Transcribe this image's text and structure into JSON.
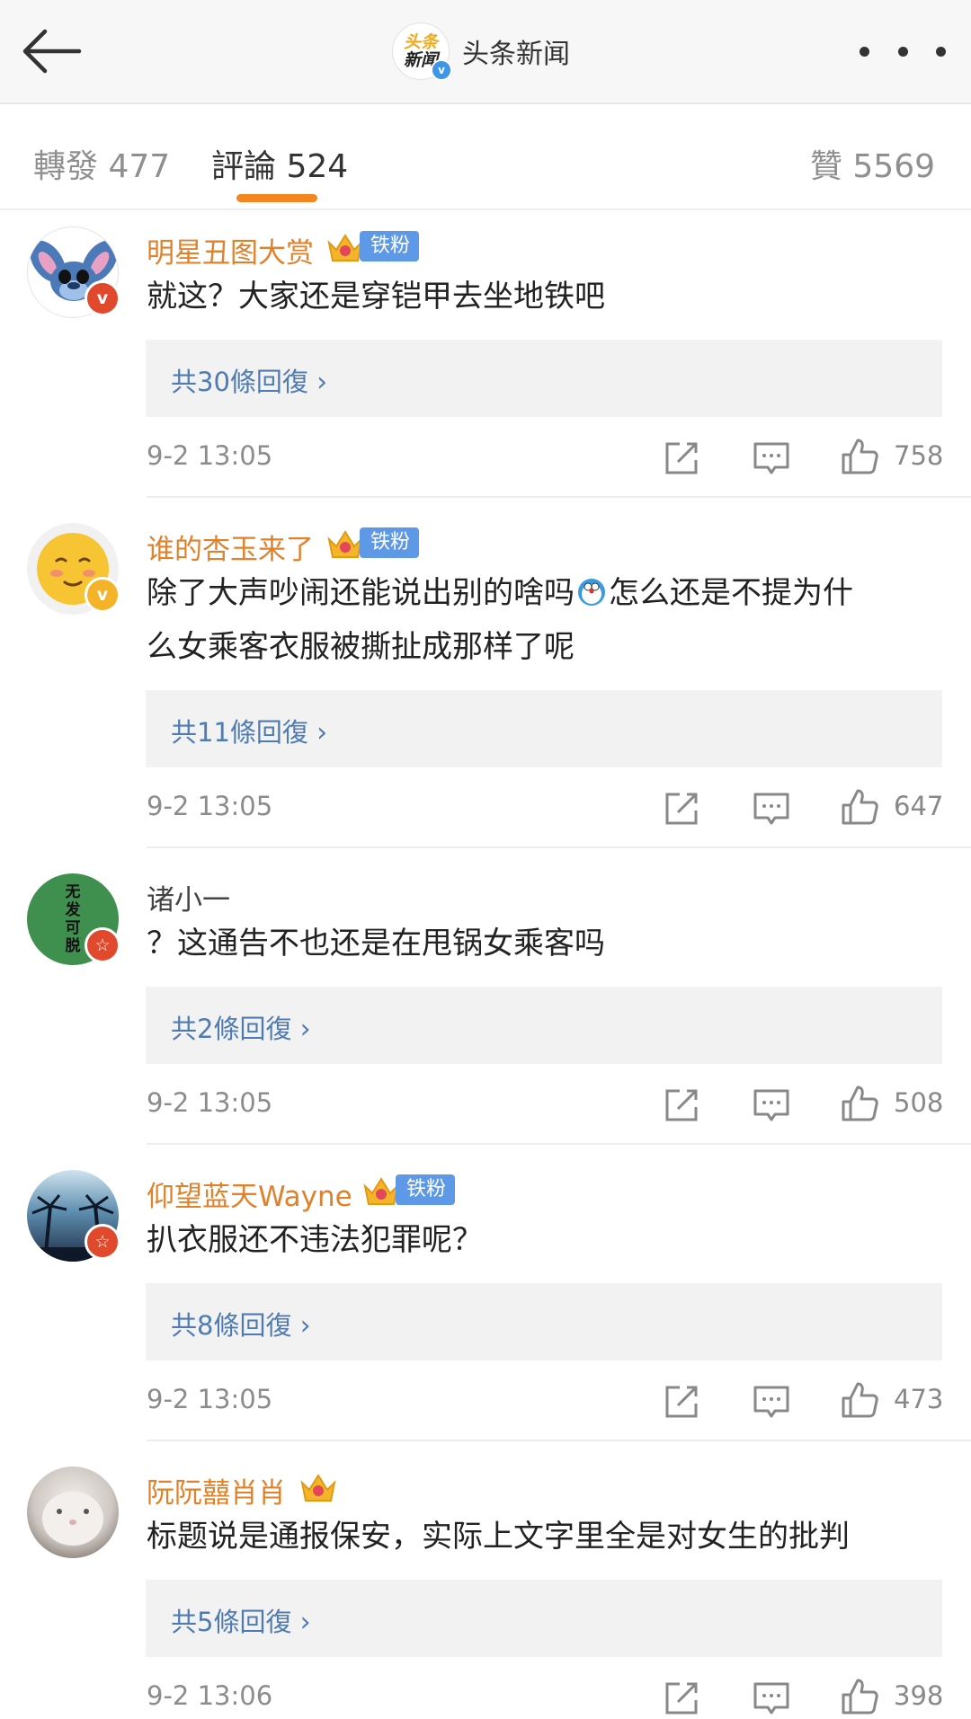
{
  "header": {
    "brand_name": "头条新闻",
    "logo_line1": "头条",
    "logo_line2": "新闻",
    "verified_mark": "v"
  },
  "tabs": [
    {
      "label": "轉發 477"
    },
    {
      "label": "評論 524"
    },
    {
      "label": "贊 5569"
    }
  ],
  "comments": [
    {
      "username": "明星丑图大赏",
      "fan_badge": "铁粉",
      "avatar_badge": "v",
      "text": "就这？大家还是穿铠甲去坐地铁吧",
      "replies": "共30條回復",
      "time": "9-2 13:05",
      "likes": "758"
    },
    {
      "username": "谁的杏玉来了",
      "fan_badge": "铁粉",
      "avatar_badge": "v",
      "text_line1": "除了大声吵闹还能说出别的啥吗",
      "text_line1b": "怎么还是不提为什",
      "text_line2": "么女乘客衣服被撕扯成那样了呢",
      "replies": "共11條回復",
      "time": "9-2 13:05",
      "likes": "647"
    },
    {
      "username": "诸小一",
      "avatar_text": "无发可脱",
      "avatar_badge": "☆",
      "text": "？这通告不也还是在甩锅女乘客吗",
      "replies": "共2條回復",
      "time": "9-2 13:05",
      "likes": "508"
    },
    {
      "username": "仰望蓝天Wayne",
      "fan_badge": "铁粉",
      "avatar_badge": "☆",
      "text": "扒衣服还不违法犯罪呢？",
      "replies": "共8條回復",
      "time": "9-2 13:05",
      "likes": "473"
    },
    {
      "username": "阮阮囍肖肖",
      "text": "标题说是通报保安，实际上文字里全是对女生的批判",
      "replies": "共5條回復",
      "time": "9-2 13:06",
      "likes": "398"
    }
  ],
  "chevron": "›",
  "icons": [
    "back-arrow-icon",
    "more-icon",
    "crown-icon",
    "repost-icon",
    "comment-icon",
    "like-icon"
  ],
  "colors": {
    "accent": "#f4851f",
    "username": "#e0812b",
    "reply_link": "#4f7bb3",
    "fan_badge": "#5e99e8"
  }
}
